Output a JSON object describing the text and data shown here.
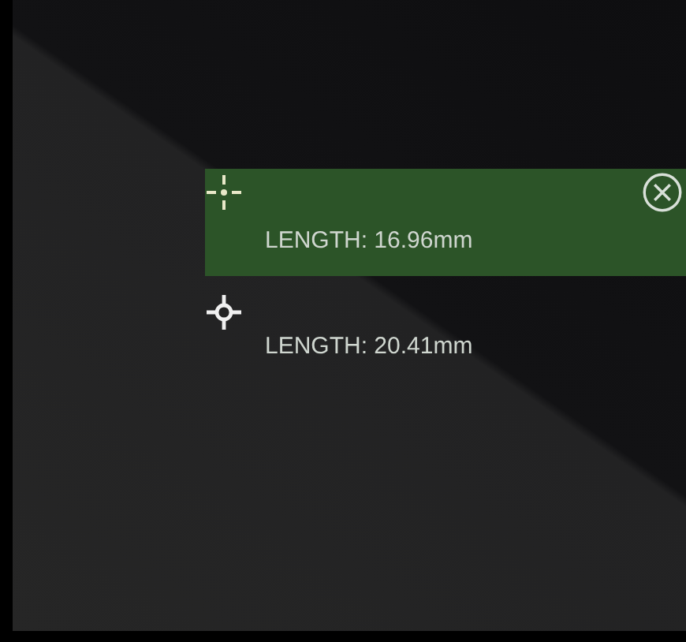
{
  "measurements": [
    {
      "kind": "crosshair",
      "label": "LENGTH: 16.96mm",
      "selected": true
    },
    {
      "kind": "target",
      "label": "LENGTH: 20.41mm",
      "selected": false
    }
  ]
}
